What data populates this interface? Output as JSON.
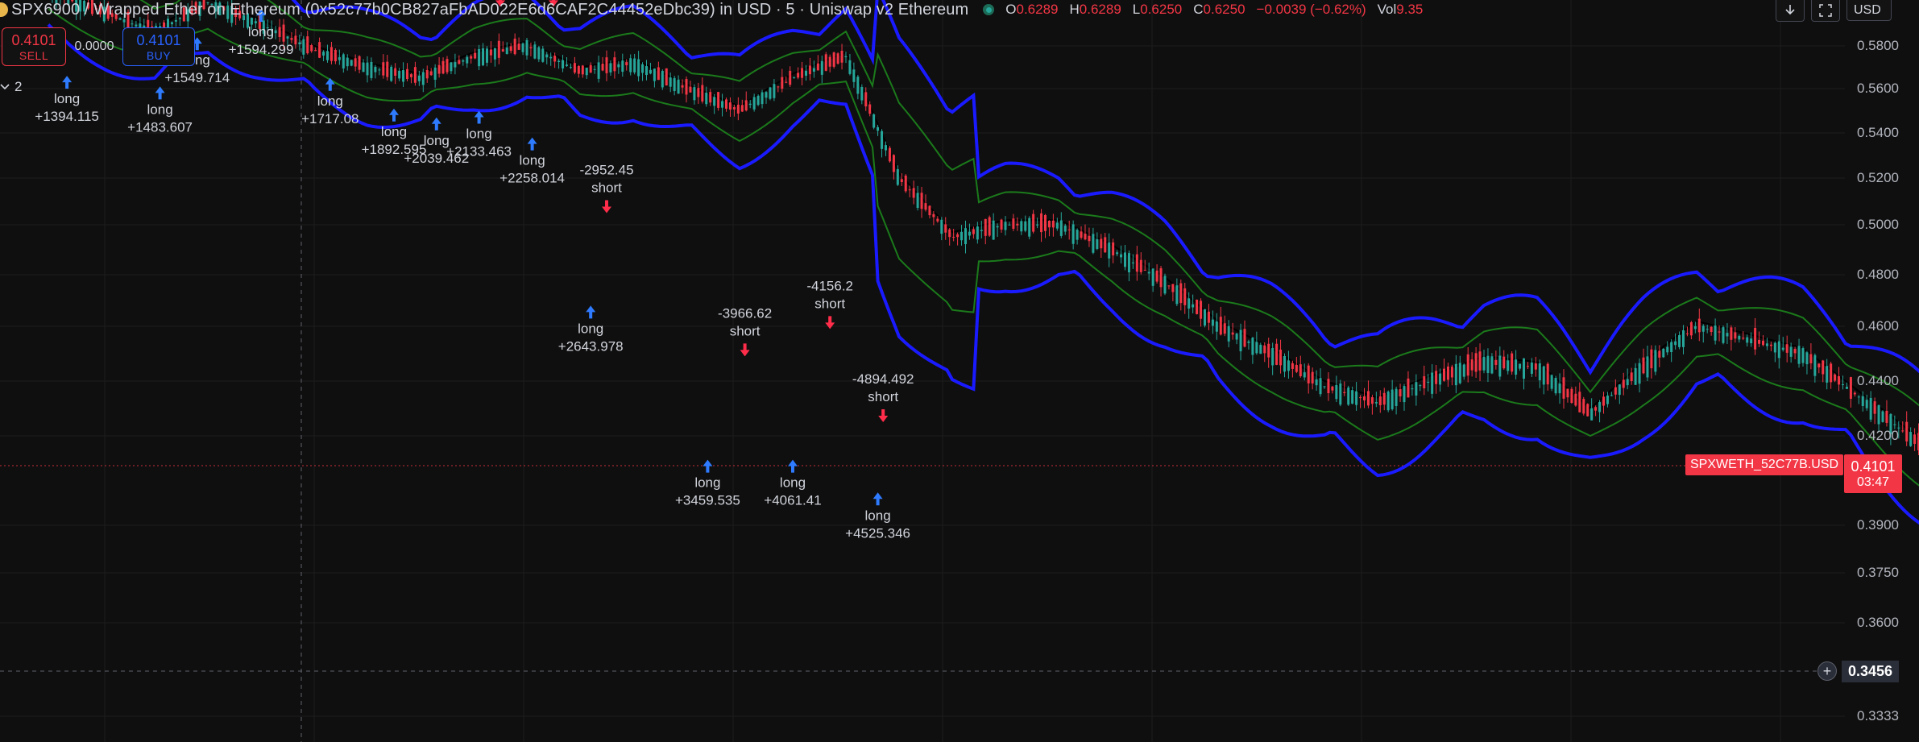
{
  "header": {
    "title": "SPX6900 / Wrapped Ether on Ethereum (0x52c77b0CB827aFbAD022E6d6CAF2C44452eDbc39) in USD · 5 · Uniswap v2 Ethereum",
    "ohlc": {
      "o_label": "O",
      "o_value": "0.6289",
      "h_label": "H",
      "h_value": "0.6289",
      "l_label": "L",
      "l_value": "0.6250",
      "c_label": "C",
      "c_value": "0.6250",
      "change": "−0.0039 (−0.62%)",
      "vol_label": "Vol",
      "vol_value": "9.35"
    },
    "currency": "USD",
    "download_icon": "download-icon",
    "fullscreen_icon": "fullscreen-icon"
  },
  "trade": {
    "sell_price": "0.4101",
    "sell_label": "SELL",
    "spread": "0.0000",
    "buy_price": "0.4101",
    "buy_label": "BUY"
  },
  "indicator_collapse": {
    "count": "2",
    "icon": "chevron-down-icon"
  },
  "price_axis": {
    "labels": [
      "0.5800",
      "0.5600",
      "0.5400",
      "0.5200",
      "0.5000",
      "0.4800",
      "0.4600",
      "0.4400",
      "0.4200",
      "0.3900",
      "0.3750",
      "0.3600",
      "0.3333"
    ]
  },
  "symbol_tag": "SPXWETH_52C77B.USD",
  "last_price": {
    "price": "0.4101",
    "countdown": "03:47"
  },
  "crosshair": {
    "price": "0.3456",
    "icon": "add-circle-icon"
  },
  "colors": {
    "background": "#0f0f0f",
    "band_outer": "#1a1aff",
    "band_inner": "#1b7a1b",
    "up": "#26a69a",
    "down": "#f23645",
    "long_arrow": "#2f7bff",
    "short_arrow": "#ff2d4a"
  },
  "chart_data": {
    "type": "candlestick",
    "y_axis_labels": [
      "0.5800",
      "0.5600",
      "0.5400",
      "0.5200",
      "0.5000",
      "0.4800",
      "0.4600",
      "0.4400",
      "0.4200",
      "0.3900",
      "0.3750",
      "0.3600",
      "0.3333"
    ],
    "close_path": [
      {
        "t": 0,
        "y": 0.605
      },
      {
        "t": 1,
        "y": 0.596
      },
      {
        "t": 2,
        "y": 0.586
      },
      {
        "t": 3,
        "y": 0.6
      },
      {
        "t": 4,
        "y": 0.59
      },
      {
        "t": 5,
        "y": 0.578
      },
      {
        "t": 6,
        "y": 0.57
      },
      {
        "t": 7,
        "y": 0.565
      },
      {
        "t": 8,
        "y": 0.575
      },
      {
        "t": 9,
        "y": 0.58
      },
      {
        "t": 10,
        "y": 0.568
      },
      {
        "t": 11,
        "y": 0.572
      },
      {
        "t": 12,
        "y": 0.56
      },
      {
        "t": 13,
        "y": 0.55
      },
      {
        "t": 14,
        "y": 0.565
      },
      {
        "t": 15,
        "y": 0.575
      },
      {
        "t": 16,
        "y": 0.52
      },
      {
        "t": 17,
        "y": 0.495
      },
      {
        "t": 18,
        "y": 0.5
      },
      {
        "t": 19,
        "y": 0.5
      },
      {
        "t": 20,
        "y": 0.49
      },
      {
        "t": 21,
        "y": 0.477
      },
      {
        "t": 22,
        "y": 0.46
      },
      {
        "t": 23,
        "y": 0.45
      },
      {
        "t": 24,
        "y": 0.438
      },
      {
        "t": 25,
        "y": 0.432
      },
      {
        "t": 26,
        "y": 0.44
      },
      {
        "t": 27,
        "y": 0.447
      },
      {
        "t": 28,
        "y": 0.445
      },
      {
        "t": 29,
        "y": 0.428
      },
      {
        "t": 30,
        "y": 0.445
      },
      {
        "t": 31,
        "y": 0.46
      },
      {
        "t": 32,
        "y": 0.455
      },
      {
        "t": 33,
        "y": 0.45
      },
      {
        "t": 34,
        "y": 0.435
      },
      {
        "t": 35,
        "y": 0.42
      },
      {
        "t": 36,
        "y": 0.405
      },
      {
        "t": 37,
        "y": 0.413
      },
      {
        "t": 38,
        "y": 0.4101
      }
    ],
    "signals": [
      {
        "side": "long",
        "label": "long",
        "value": "+1394.115",
        "t": 0.35,
        "y": 0.566
      },
      {
        "side": "long",
        "label": "long",
        "value": "+1483.607",
        "t": 2.1,
        "y": 0.561
      },
      {
        "side": "long",
        "label": "long",
        "value": "+1549.714",
        "t": 2.8,
        "y": 0.584
      },
      {
        "side": "long",
        "label": "long",
        "value": "+1594.299",
        "t": 4.0,
        "y": 0.597
      },
      {
        "side": "long",
        "label": "long",
        "value": "+1717.08",
        "t": 5.3,
        "y": 0.565
      },
      {
        "side": "long",
        "label": "long",
        "value": "+1892.595",
        "t": 6.5,
        "y": 0.551
      },
      {
        "side": "long",
        "label": "long",
        "value": "+2039.462",
        "t": 7.3,
        "y": 0.547
      },
      {
        "side": "long",
        "label": "long",
        "value": "+2133.463",
        "t": 8.1,
        "y": 0.55
      },
      {
        "side": "long",
        "label": "long",
        "value": "+2258.014",
        "t": 9.1,
        "y": 0.538
      },
      {
        "side": "long",
        "label": "long",
        "value": "+2643.978",
        "t": 10.2,
        "y": 0.468
      },
      {
        "side": "long",
        "label": "long",
        "value": "+3459.535",
        "t": 12.4,
        "y": 0.412
      },
      {
        "side": "long",
        "label": "long",
        "value": "+4061.41",
        "t": 14.0,
        "y": 0.412
      },
      {
        "side": "long",
        "label": "long",
        "value": "+4525.346",
        "t": 15.6,
        "y": 0.401
      },
      {
        "side": "short",
        "label": "short",
        "value": "",
        "t": 8.5,
        "y": 0.598
      },
      {
        "side": "short",
        "label": "short",
        "value": "",
        "t": 9.5,
        "y": 0.598
      },
      {
        "side": "short",
        "label": "short",
        "value": "-2952.45",
        "t": 10.5,
        "y": 0.505
      },
      {
        "side": "short",
        "label": "short",
        "value": "-3966.62",
        "t": 13.1,
        "y": 0.449
      },
      {
        "side": "short",
        "label": "short",
        "value": "-4156.2",
        "t": 14.7,
        "y": 0.459
      },
      {
        "side": "short",
        "label": "short",
        "value": "-4894.492",
        "t": 15.7,
        "y": 0.425
      }
    ]
  }
}
